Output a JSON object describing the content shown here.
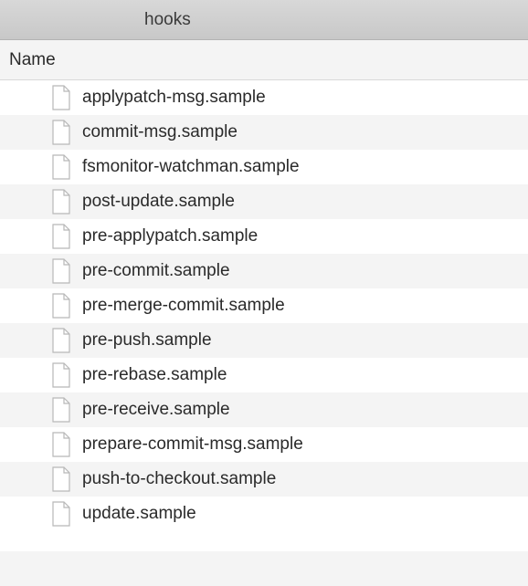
{
  "titlebar": {
    "title": "hooks"
  },
  "column_header": {
    "label": "Name"
  },
  "files": [
    {
      "name": "applypatch-msg.sample"
    },
    {
      "name": "commit-msg.sample"
    },
    {
      "name": "fsmonitor-watchman.sample"
    },
    {
      "name": "post-update.sample"
    },
    {
      "name": "pre-applypatch.sample"
    },
    {
      "name": "pre-commit.sample"
    },
    {
      "name": "pre-merge-commit.sample"
    },
    {
      "name": "pre-push.sample"
    },
    {
      "name": "pre-rebase.sample"
    },
    {
      "name": "pre-receive.sample"
    },
    {
      "name": "prepare-commit-msg.sample"
    },
    {
      "name": "push-to-checkout.sample"
    },
    {
      "name": "update.sample"
    }
  ]
}
